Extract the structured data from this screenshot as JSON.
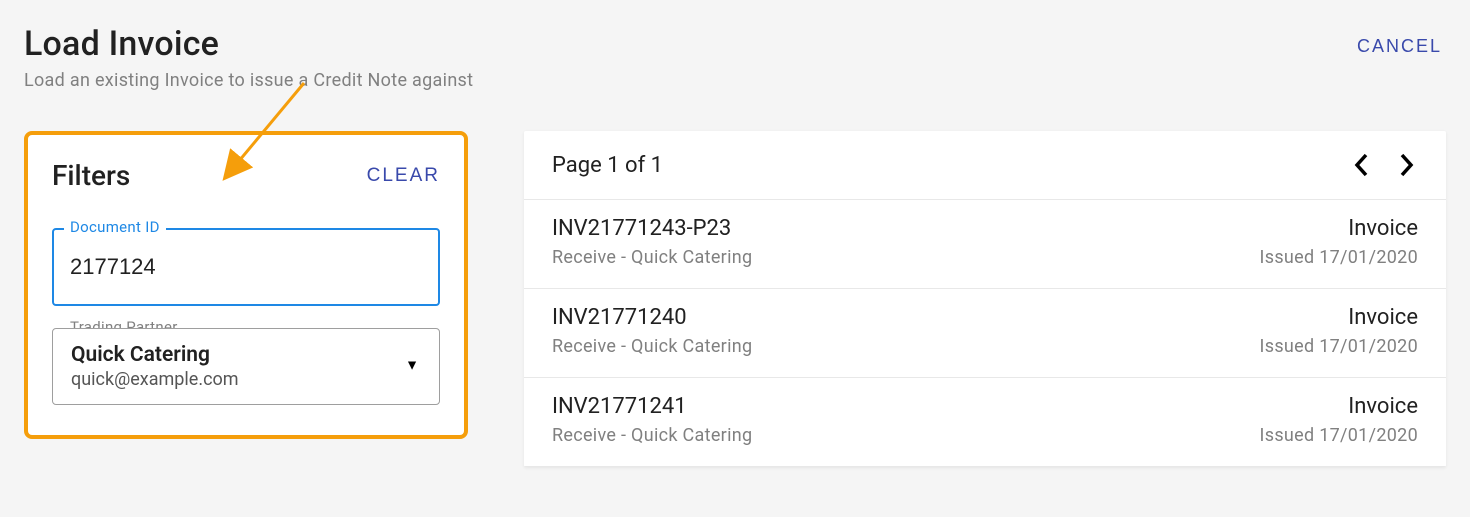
{
  "header": {
    "title": "Load Invoice",
    "subtitle": "Load an existing Invoice to issue a Credit Note against",
    "cancel_label": "CANCEL"
  },
  "filters": {
    "title": "Filters",
    "clear_label": "CLEAR",
    "document_id": {
      "label": "Document ID",
      "value": "2177124"
    },
    "trading_partner": {
      "label": "Trading Partner",
      "selected_name": "Quick Catering",
      "selected_email": "quick@example.com"
    }
  },
  "results": {
    "pager_text": "Page 1 of 1",
    "rows": [
      {
        "id": "INV21771243-P23",
        "subtitle": "Receive - Quick Catering",
        "type": "Invoice",
        "issued": "Issued 17/01/2020"
      },
      {
        "id": "INV21771240",
        "subtitle": "Receive - Quick Catering",
        "type": "Invoice",
        "issued": "Issued 17/01/2020"
      },
      {
        "id": "INV21771241",
        "subtitle": "Receive - Quick Catering",
        "type": "Invoice",
        "issued": "Issued 17/01/2020"
      }
    ]
  },
  "colors": {
    "accent_blue": "#3949ab",
    "focus_blue": "#1e88e5",
    "highlight_orange": "#f59e0b"
  }
}
